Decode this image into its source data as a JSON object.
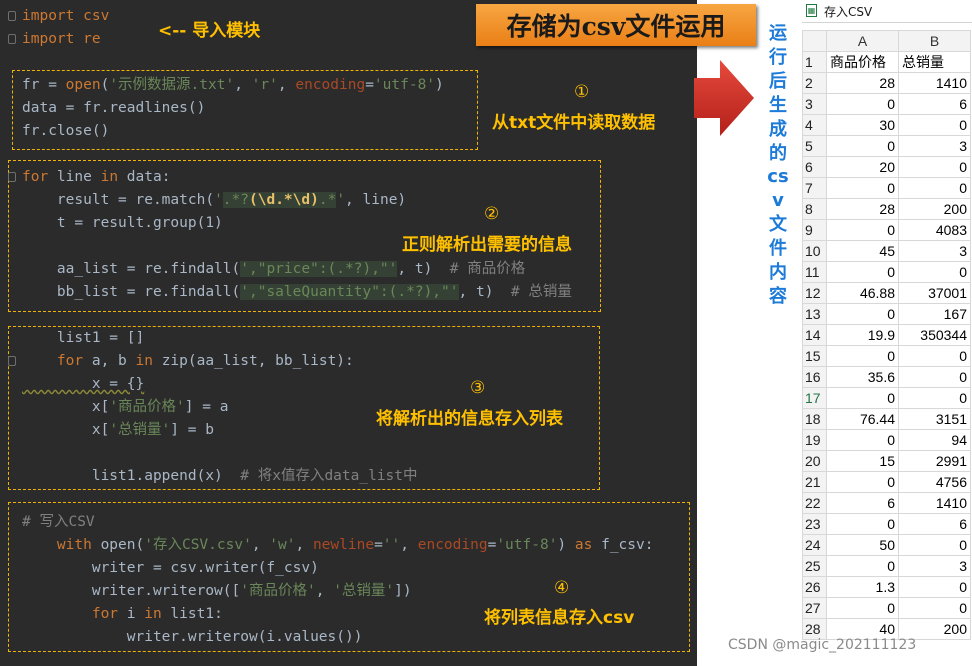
{
  "banner": {
    "title": "存储为csv文件运用"
  },
  "code": {
    "import_1": "import csv",
    "import_2": "import re",
    "import_note": "<-- 导入模块",
    "open_line": {
      "a": "fr = ",
      "open": "open",
      "b": "(",
      "s1": "'示例数据源.txt'",
      "c": ", ",
      "s2": "'r'",
      "d": ", ",
      "param": "encoding",
      "e": "=",
      "s3": "'utf-8'",
      "f": ")"
    },
    "readlines": "data = fr.readlines()",
    "close": "fr.close()",
    "for_line": {
      "kw_for": "for",
      "a": " line ",
      "kw_in": "in",
      "b": " data:"
    },
    "match_line": {
      "a": "    result = re.match(",
      "q1": "'",
      "r1": ".*?",
      "r2": "(\\d.*\\d)",
      "r3": ".*",
      "q2": "'",
      "b": ", line)"
    },
    "group_line": "    t = result.group(1)",
    "aa_line": {
      "a": "    aa_list = re.findall(",
      "s": "',\"price\":(.*?),\"'",
      "b": ", t)  ",
      "cmt": "# 商品价格"
    },
    "bb_line": {
      "a": "    bb_list = re.findall(",
      "s": "',\"saleQuantity\":(.*?),\"'",
      "b": ", t)  ",
      "cmt": "# 总销量"
    },
    "list1_line": "    list1 = []",
    "for_zip": {
      "kw_for": "    for",
      "a": " a, b ",
      "kw_in": "in",
      "b": " zip(aa_list, bb_list):"
    },
    "x_line": "        x = {}",
    "x_price": {
      "a": "        x[",
      "s": "'商品价格'",
      "b": "] = a"
    },
    "x_qty": {
      "a": "        x[",
      "s": "'总销量'",
      "b": "] = b"
    },
    "append_line": {
      "a": "        list1.append(x)  ",
      "cmt": "# 将x值存入data_list中"
    },
    "write_cmt": "# 写入CSV",
    "with_line": {
      "kw_with": "    with",
      "a": " open(",
      "s1": "'存入CSV.csv'",
      "b": ", ",
      "s2": "'w'",
      "c": ", ",
      "p1": "newline",
      "d": "=",
      "s3": "''",
      "e": ", ",
      "p2": "encoding",
      "f": "=",
      "s4": "'utf-8'",
      "g": ") ",
      "kw_as": "as",
      "h": " f_csv:"
    },
    "writer_line": "        writer = csv.writer(f_csv)",
    "writerow_line": {
      "a": "        writer.writerow([",
      "s1": "'商品价格'",
      "b": ", ",
      "s2": "'总销量'",
      "c": "])"
    },
    "for_i": {
      "kw_for": "        for",
      "a": " i ",
      "kw_in": "in",
      "b": " list1:"
    },
    "writerow_i": "            writer.writerow(i.values())"
  },
  "annotations": [
    {
      "num": "①",
      "text": "从txt文件中读取数据"
    },
    {
      "num": "②",
      "text": "正则解析出需要的信息"
    },
    {
      "num": "③",
      "text": "将解析出的信息存入列表"
    },
    {
      "num": "④",
      "text": "将列表信息存入csv"
    }
  ],
  "caption_chars": [
    "运",
    "行",
    "后",
    "生",
    "成",
    "的",
    "cs",
    "v",
    "文",
    "件",
    "内",
    "容"
  ],
  "sheet": {
    "tab_label": "存入CSV",
    "col_a": "A",
    "col_b": "B",
    "active_row": "17",
    "rows": [
      [
        "1",
        "商品价格",
        "总销量"
      ],
      [
        "2",
        "28",
        "1410"
      ],
      [
        "3",
        "0",
        "6"
      ],
      [
        "4",
        "30",
        "0"
      ],
      [
        "5",
        "0",
        "3"
      ],
      [
        "6",
        "20",
        "0"
      ],
      [
        "7",
        "0",
        "0"
      ],
      [
        "8",
        "28",
        "200"
      ],
      [
        "9",
        "0",
        "4083"
      ],
      [
        "10",
        "45",
        "3"
      ],
      [
        "11",
        "0",
        "0"
      ],
      [
        "12",
        "46.88",
        "37001"
      ],
      [
        "13",
        "0",
        "167"
      ],
      [
        "14",
        "19.9",
        "350344"
      ],
      [
        "15",
        "0",
        "0"
      ],
      [
        "16",
        "35.6",
        "0"
      ],
      [
        "17",
        "0",
        "0"
      ],
      [
        "18",
        "76.44",
        "3151"
      ],
      [
        "19",
        "0",
        "94"
      ],
      [
        "20",
        "15",
        "2991"
      ],
      [
        "21",
        "0",
        "4756"
      ],
      [
        "22",
        "6",
        "1410"
      ],
      [
        "23",
        "0",
        "6"
      ],
      [
        "24",
        "50",
        "0"
      ],
      [
        "25",
        "0",
        "3"
      ],
      [
        "26",
        "1.3",
        "0"
      ],
      [
        "27",
        "0",
        "0"
      ],
      [
        "28",
        "40",
        "200"
      ]
    ]
  },
  "watermark": "CSDN @magic_202111123"
}
